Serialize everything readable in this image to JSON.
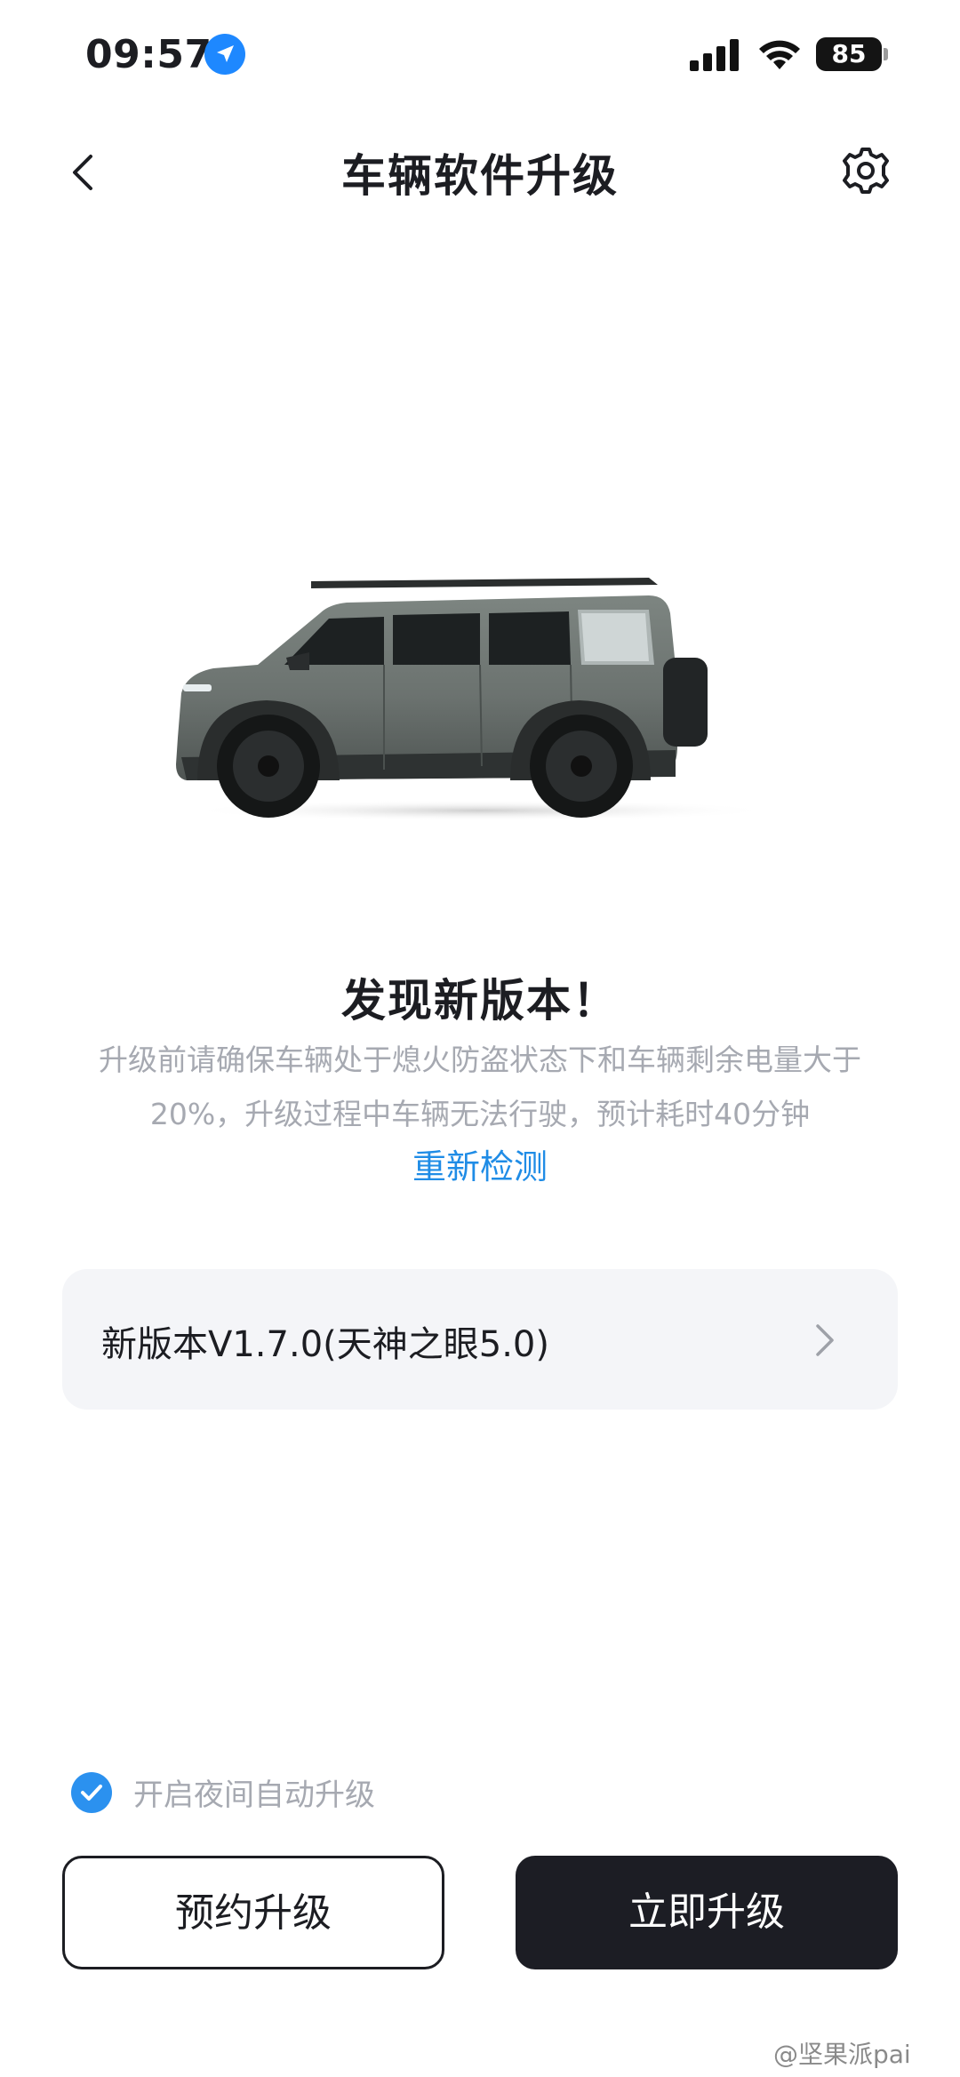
{
  "status_bar": {
    "time": "09:57",
    "battery": "85",
    "icons": [
      "location-arrow-icon",
      "cellular-signal-icon",
      "wifi-icon",
      "battery-icon"
    ]
  },
  "nav": {
    "title": "车辆软件升级",
    "back_icon": "chevron-left-icon",
    "settings_icon": "gear-icon"
  },
  "hero": {
    "image": "vehicle-side-view",
    "car_color": "#6f7672"
  },
  "update": {
    "headline": "发现新版本！",
    "description_line1": "升级前请确保车辆处于熄火防盗状态下和车辆剩余电量大于",
    "description_line2": "20%，升级过程中车辆无法行驶，预计耗时40分钟",
    "recheck": "重新检测"
  },
  "version": {
    "label": "新版本V1.7.0(天神之眼5.0)",
    "icon": "chevron-right-icon"
  },
  "auto_upgrade": {
    "label": "开启夜间自动升级",
    "checked": true
  },
  "actions": {
    "schedule": "预约升级",
    "upgrade_now": "立即升级"
  },
  "watermark": "@坚果派pai",
  "colors": {
    "accent": "#1f8ce6",
    "check": "#2b91ef",
    "primary_button": "#1c1d24",
    "card_bg": "#f4f5f8",
    "muted_text": "#a6a9b1"
  }
}
